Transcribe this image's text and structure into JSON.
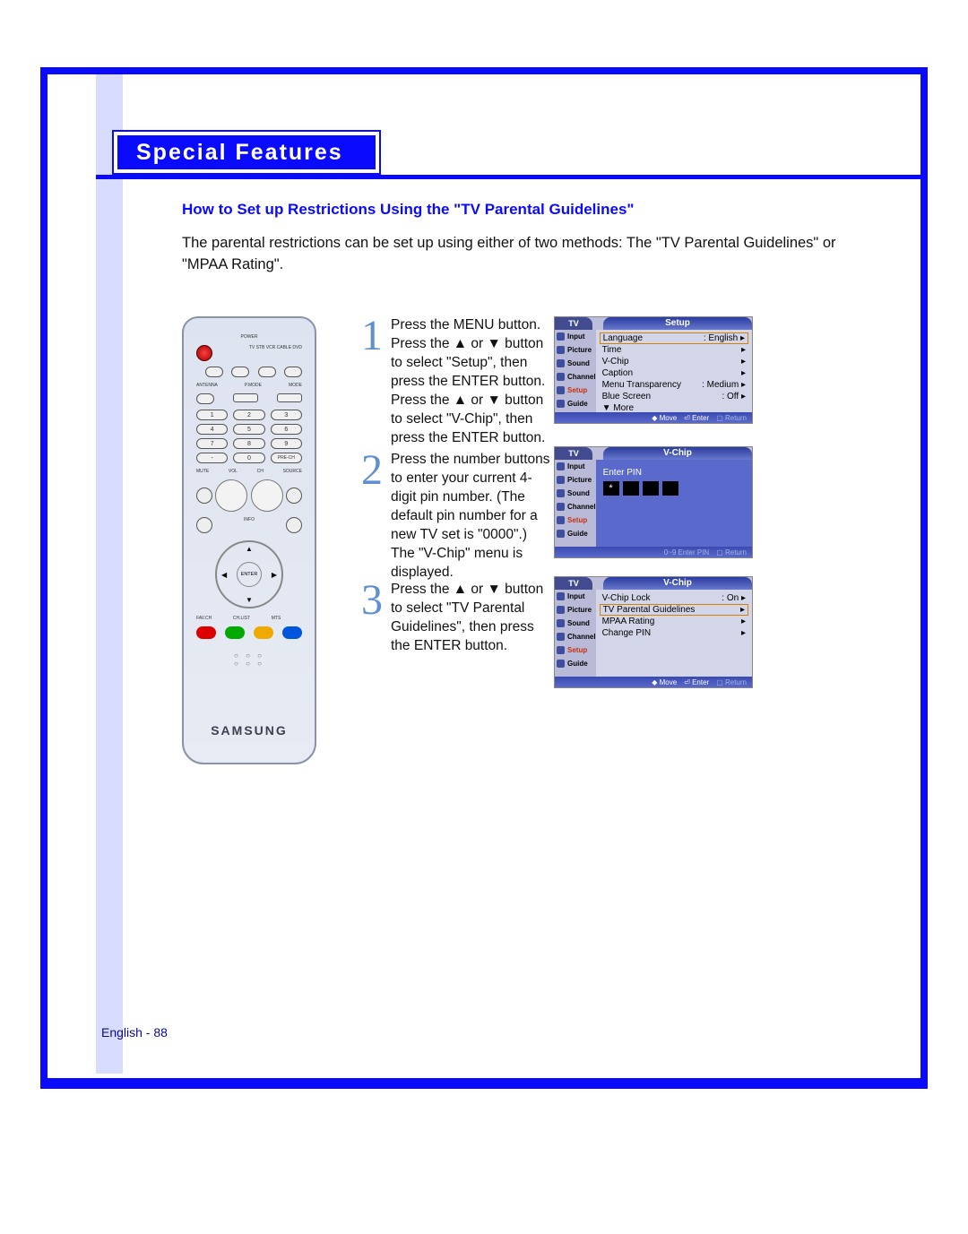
{
  "section_title": "Special Features",
  "subheading": "How to Set up Restrictions Using the \"TV Parental Guidelines\"",
  "intro_text": "The parental restrictions can be set up using either of two methods: The \"TV Parental Guidelines\" or \"MPAA Rating\".",
  "remote_brand": "SAMSUNG",
  "steps": {
    "s1": {
      "num": "1",
      "text": "Press the MENU button. Press the ▲ or ▼ button to select \"Setup\", then press the ENTER button.\nPress the ▲ or ▼ button to select \"V-Chip\", then press the ENTER button."
    },
    "s2": {
      "num": "2",
      "text": "Press the number buttons to enter your current 4-digit pin number.\n(The default pin number for a new TV set is \"0000\".) The \"V-Chip\" menu is displayed."
    },
    "s3": {
      "num": "3",
      "text": "Press the ▲ or ▼ button to select \"TV Parental Guidelines\", then press the ENTER button."
    }
  },
  "osd_sidebar": {
    "tv_label": "TV",
    "items": [
      "Input",
      "Picture",
      "Sound",
      "Channel",
      "Setup",
      "Guide"
    ],
    "active_index": 4
  },
  "osd1": {
    "title": "Setup",
    "rows": [
      {
        "l": "Language",
        "r": ": English",
        "arrow": true,
        "sel": true
      },
      {
        "l": "Time",
        "r": "",
        "arrow": true
      },
      {
        "l": "V-Chip",
        "r": "",
        "arrow": true
      },
      {
        "l": "Caption",
        "r": "",
        "arrow": true
      },
      {
        "l": "Menu Transparency",
        "r": ": Medium",
        "arrow": true
      },
      {
        "l": "Blue Screen",
        "r": ": Off",
        "arrow": true
      },
      {
        "l": "▼ More",
        "r": "",
        "arrow": false
      }
    ],
    "foot": {
      "move": "Move",
      "enter": "Enter",
      "ret": "Return"
    }
  },
  "osd2": {
    "title": "V-Chip",
    "pin_label": "Enter PIN",
    "pin": [
      "*",
      "",
      "",
      ""
    ],
    "foot": {
      "hint": "0~9 Enter PIN",
      "ret": "Return"
    }
  },
  "osd3": {
    "title": "V-Chip",
    "rows": [
      {
        "l": "V-Chip Lock",
        "r": ": On",
        "arrow": true
      },
      {
        "l": "TV Parental Guidelines",
        "r": "",
        "arrow": true,
        "sel": true
      },
      {
        "l": "MPAA Rating",
        "r": "",
        "arrow": true
      },
      {
        "l": "Change PIN",
        "r": "",
        "arrow": true
      }
    ],
    "foot": {
      "move": "Move",
      "enter": "Enter",
      "ret": "Return"
    }
  },
  "footer": "English - 88"
}
